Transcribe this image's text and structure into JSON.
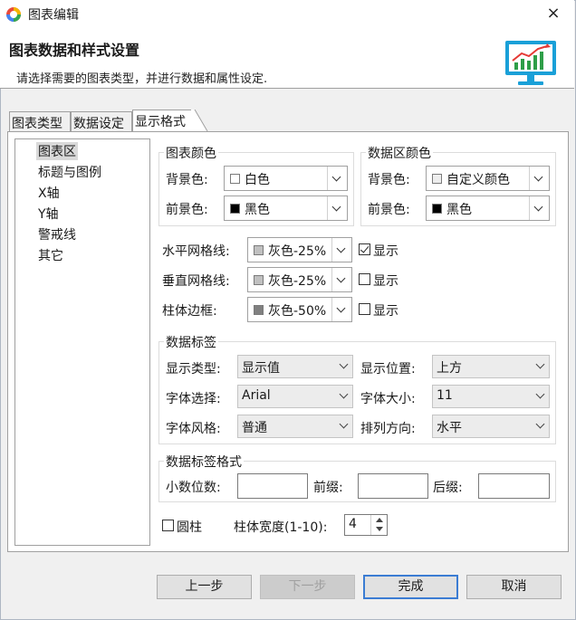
{
  "window": {
    "title": "图表编辑",
    "close_icon": "×"
  },
  "header": {
    "title": "图表数据和样式设置",
    "subtitle": "请选择需要的图表类型，并进行数据和属性设定."
  },
  "tabs": [
    {
      "label": "图表类型"
    },
    {
      "label": "数据设定"
    },
    {
      "label": "显示格式"
    }
  ],
  "tree": {
    "items": [
      {
        "label": "图表区",
        "selected": true
      },
      {
        "label": "标题与图例"
      },
      {
        "label": "X轴"
      },
      {
        "label": "Y轴"
      },
      {
        "label": "警戒线"
      },
      {
        "label": "其它"
      }
    ]
  },
  "chart_color": {
    "title": "图表颜色",
    "bg_label": "背景色:",
    "bg_value": "白色",
    "bg_swatch": "#ffffff",
    "fg_label": "前景色:",
    "fg_value": "黑色",
    "fg_swatch": "#000000"
  },
  "data_area_color": {
    "title": "数据区颜色",
    "bg_label": "背景色:",
    "bg_value": "自定义颜色",
    "bg_swatch": "#eeeeee",
    "fg_label": "前景色:",
    "fg_value": "黑色",
    "fg_swatch": "#000000"
  },
  "grid": {
    "h_label": "水平网格线:",
    "h_value": "灰色-25%",
    "h_swatch": "#c0c0c0",
    "h_show": "显示",
    "h_checked": true,
    "v_label": "垂直网格线:",
    "v_value": "灰色-25%",
    "v_swatch": "#c0c0c0",
    "v_show": "显示",
    "v_checked": false,
    "border_label": "柱体边框:",
    "border_value": "灰色-50%",
    "border_swatch": "#808080",
    "border_show": "显示",
    "border_checked": false
  },
  "data_labels": {
    "title": "数据标签",
    "type_label": "显示类型:",
    "type_value": "显示值",
    "pos_label": "显示位置:",
    "pos_value": "上方",
    "font_label": "字体选择:",
    "font_value": "Arial",
    "size_label": "字体大小:",
    "size_value": "11",
    "style_label": "字体风格:",
    "style_value": "普通",
    "dir_label": "排列方向:",
    "dir_value": "水平"
  },
  "label_format": {
    "title": "数据标签格式",
    "decimals_label": "小数位数:",
    "decimals_value": "",
    "prefix_label": "前缀:",
    "prefix_value": "",
    "suffix_label": "后缀:",
    "suffix_value": ""
  },
  "misc": {
    "cylinder_label": "圆柱",
    "cylinder_checked": false,
    "width_label": "柱体宽度(1-10):",
    "width_value": "4"
  },
  "buttons": {
    "prev": "上一步",
    "next": "下一步",
    "finish": "完成",
    "cancel": "取消"
  },
  "colors": {
    "accent": "#3b7cd3",
    "header_icon": "#1aa0d8"
  }
}
